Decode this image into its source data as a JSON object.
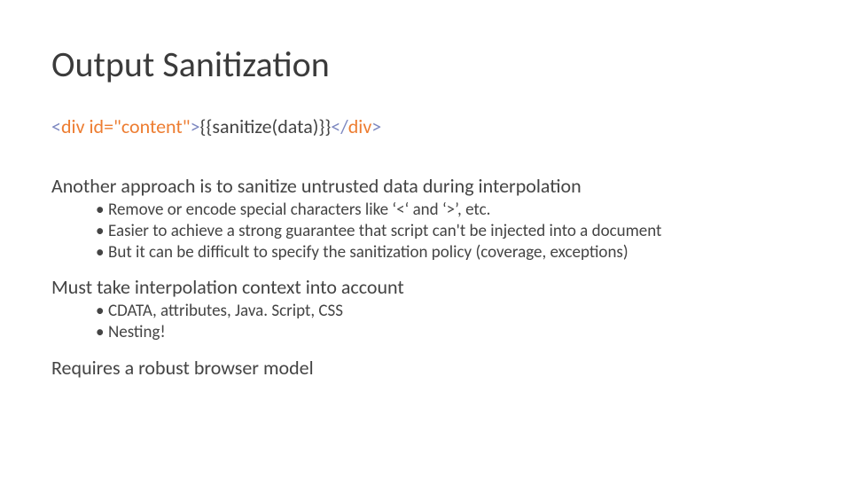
{
  "title": "Output Sanitization",
  "codeline": {
    "open_lt": "<",
    "tag": "div",
    "attr_key": " id=\"content\"",
    "open_gt": ">",
    "inner": "{{sanitize(data)}}",
    "close_lt": "</",
    "close_tag": "div",
    "close_gt": ">"
  },
  "sections": [
    {
      "heading": "Another approach is to sanitize untrusted data during interpolation",
      "bullets": [
        "Remove or encode special characters like ‘<‘ and ‘>’, etc.",
        "Easier to achieve a strong guarantee that script can't be injected into a document",
        "But it can be difficult to specify the sanitization policy (coverage, exceptions)"
      ]
    },
    {
      "heading": "Must take interpolation context into account",
      "bullets": [
        "CDATA, attributes, Java. Script, CSS",
        "Nesting!"
      ]
    },
    {
      "heading": "Requires a robust browser model",
      "bullets": []
    }
  ]
}
